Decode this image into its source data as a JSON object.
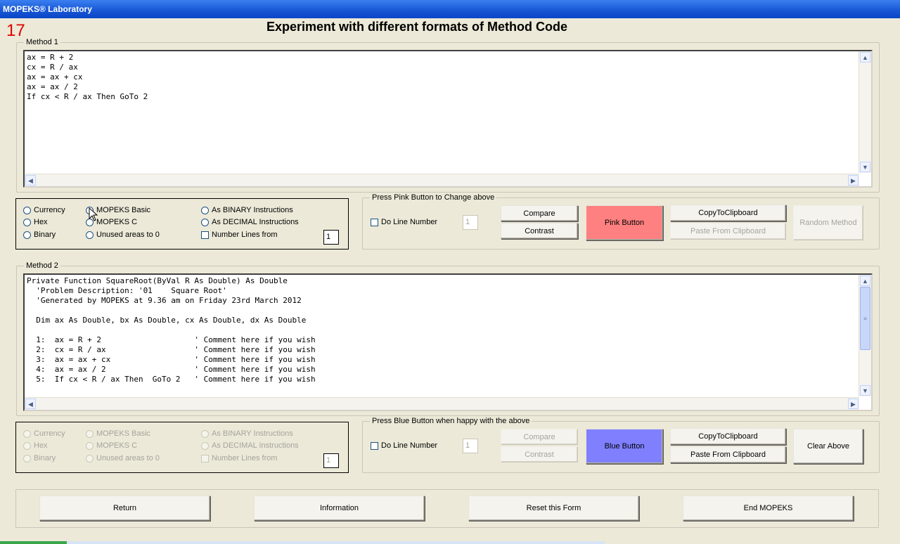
{
  "window": {
    "title": "MOPEKS® Laboratory"
  },
  "form": {
    "number": "17",
    "title": "Experiment with different formats of Method Code"
  },
  "method1": {
    "legend": "Method 1",
    "code": "ax = R + 2\ncx = R / ax\nax = ax + cx\nax = ax / 2\nIf cx < R / ax Then GoTo 2",
    "options": {
      "currency": "Currency",
      "hex": "Hex",
      "binary": "Binary",
      "mopeks_basic": "MOPEKS Basic",
      "mopeks_c": "MOPEKS C",
      "unused_areas": "Unused areas to 0",
      "as_binary": "As BINARY Instructions",
      "as_decimal": "As DECIMAL Instructions",
      "number_lines": "Number Lines  from",
      "number_lines_from": "1"
    },
    "actions": {
      "legend": "Press Pink Button to Change above",
      "do_line_number": "Do Line Number",
      "line_number_value": "1",
      "compare": "Compare",
      "contrast": "Contrast",
      "pink_button": "Pink Button",
      "copy_to_clipboard": "CopyToClipboard",
      "paste_from_clipboard": "Paste From Clipboard",
      "random_method": "Random Method"
    }
  },
  "method2": {
    "legend": "Method 2",
    "code": "Private Function SquareRoot(ByVal R As Double) As Double\n  'Problem Description: '01    Square Root'\n  'Generated by MOPEKS at 9.36 am on Friday 23rd March 2012\n\n  Dim ax As Double, bx As Double, cx As Double, dx As Double\n\n  1:  ax = R + 2                    ' Comment here if you wish\n  2:  cx = R / ax                   ' Comment here if you wish\n  3:  ax = ax + cx                  ' Comment here if you wish\n  4:  ax = ax / 2                   ' Comment here if you wish\n  5:  If cx < R / ax Then  GoTo 2   ' Comment here if you wish",
    "options": {
      "currency": "Currency",
      "hex": "Hex",
      "binary": "Binary",
      "mopeks_basic": "MOPEKS Basic",
      "mopeks_c": "MOPEKS C",
      "unused_areas": "Unused areas to 0",
      "as_binary": "As BINARY Instructions",
      "as_decimal": "As DECIMAL Instructions",
      "number_lines": "Number Lines  from",
      "number_lines_from": "1"
    },
    "actions": {
      "legend": "Press Blue Button when happy with the above",
      "do_line_number": "Do Line Number",
      "line_number_value": "1",
      "compare": "Compare",
      "contrast": "Contrast",
      "blue_button": "Blue Button",
      "copy_to_clipboard": "CopyToClipboard",
      "paste_from_clipboard": "Paste From Clipboard",
      "clear_above": "Clear Above"
    }
  },
  "footer": {
    "return": "Return",
    "information": "Information",
    "reset_form": "Reset this Form",
    "end_mopeks": "End MOPEKS"
  },
  "colors": {
    "pink": "#ff8080",
    "blue": "#8080ff",
    "form_number": "#e00000"
  }
}
